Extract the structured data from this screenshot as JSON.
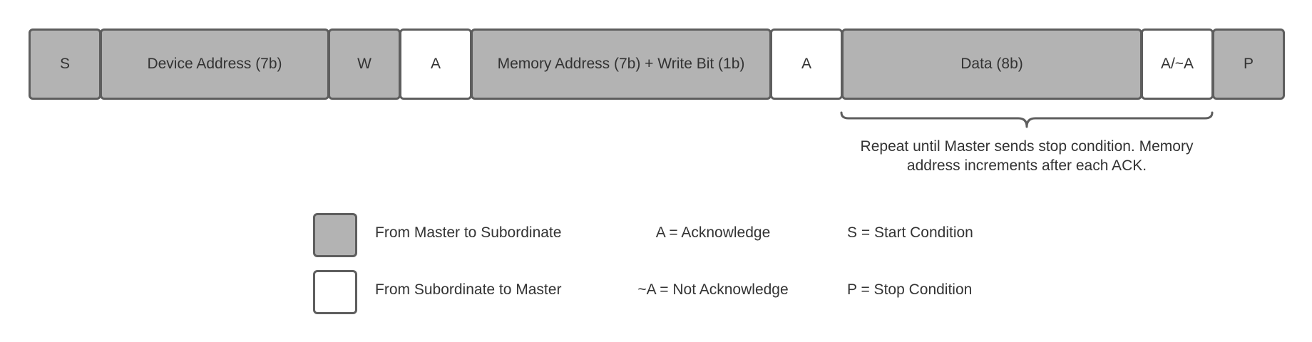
{
  "frame": {
    "fields": [
      {
        "label": "S",
        "kind": "master"
      },
      {
        "label": "Device Address (7b)",
        "kind": "master"
      },
      {
        "label": "W",
        "kind": "master"
      },
      {
        "label": "A",
        "kind": "subordinate"
      },
      {
        "label": "Memory Address (7b) + Write Bit (1b)",
        "kind": "master"
      },
      {
        "label": "A",
        "kind": "subordinate"
      },
      {
        "label": "Data (8b)",
        "kind": "master"
      },
      {
        "label": "A/~A",
        "kind": "subordinate"
      },
      {
        "label": "P",
        "kind": "master"
      }
    ],
    "repeat_note": "Repeat until Master sends stop condition. Memory address increments after each ACK."
  },
  "legend": {
    "master_label": "From Master to Subordinate",
    "subordinate_label": "From Subordinate to Master",
    "ack": "A = Acknowledge",
    "nack": "~A = Not Acknowledge",
    "start": "S = Start Condition",
    "stop": "P = Stop Condition"
  },
  "colors": {
    "master_fill": "#b3b3b3",
    "subordinate_fill": "#ffffff",
    "border": "#5e5e5e",
    "text": "#333333"
  }
}
